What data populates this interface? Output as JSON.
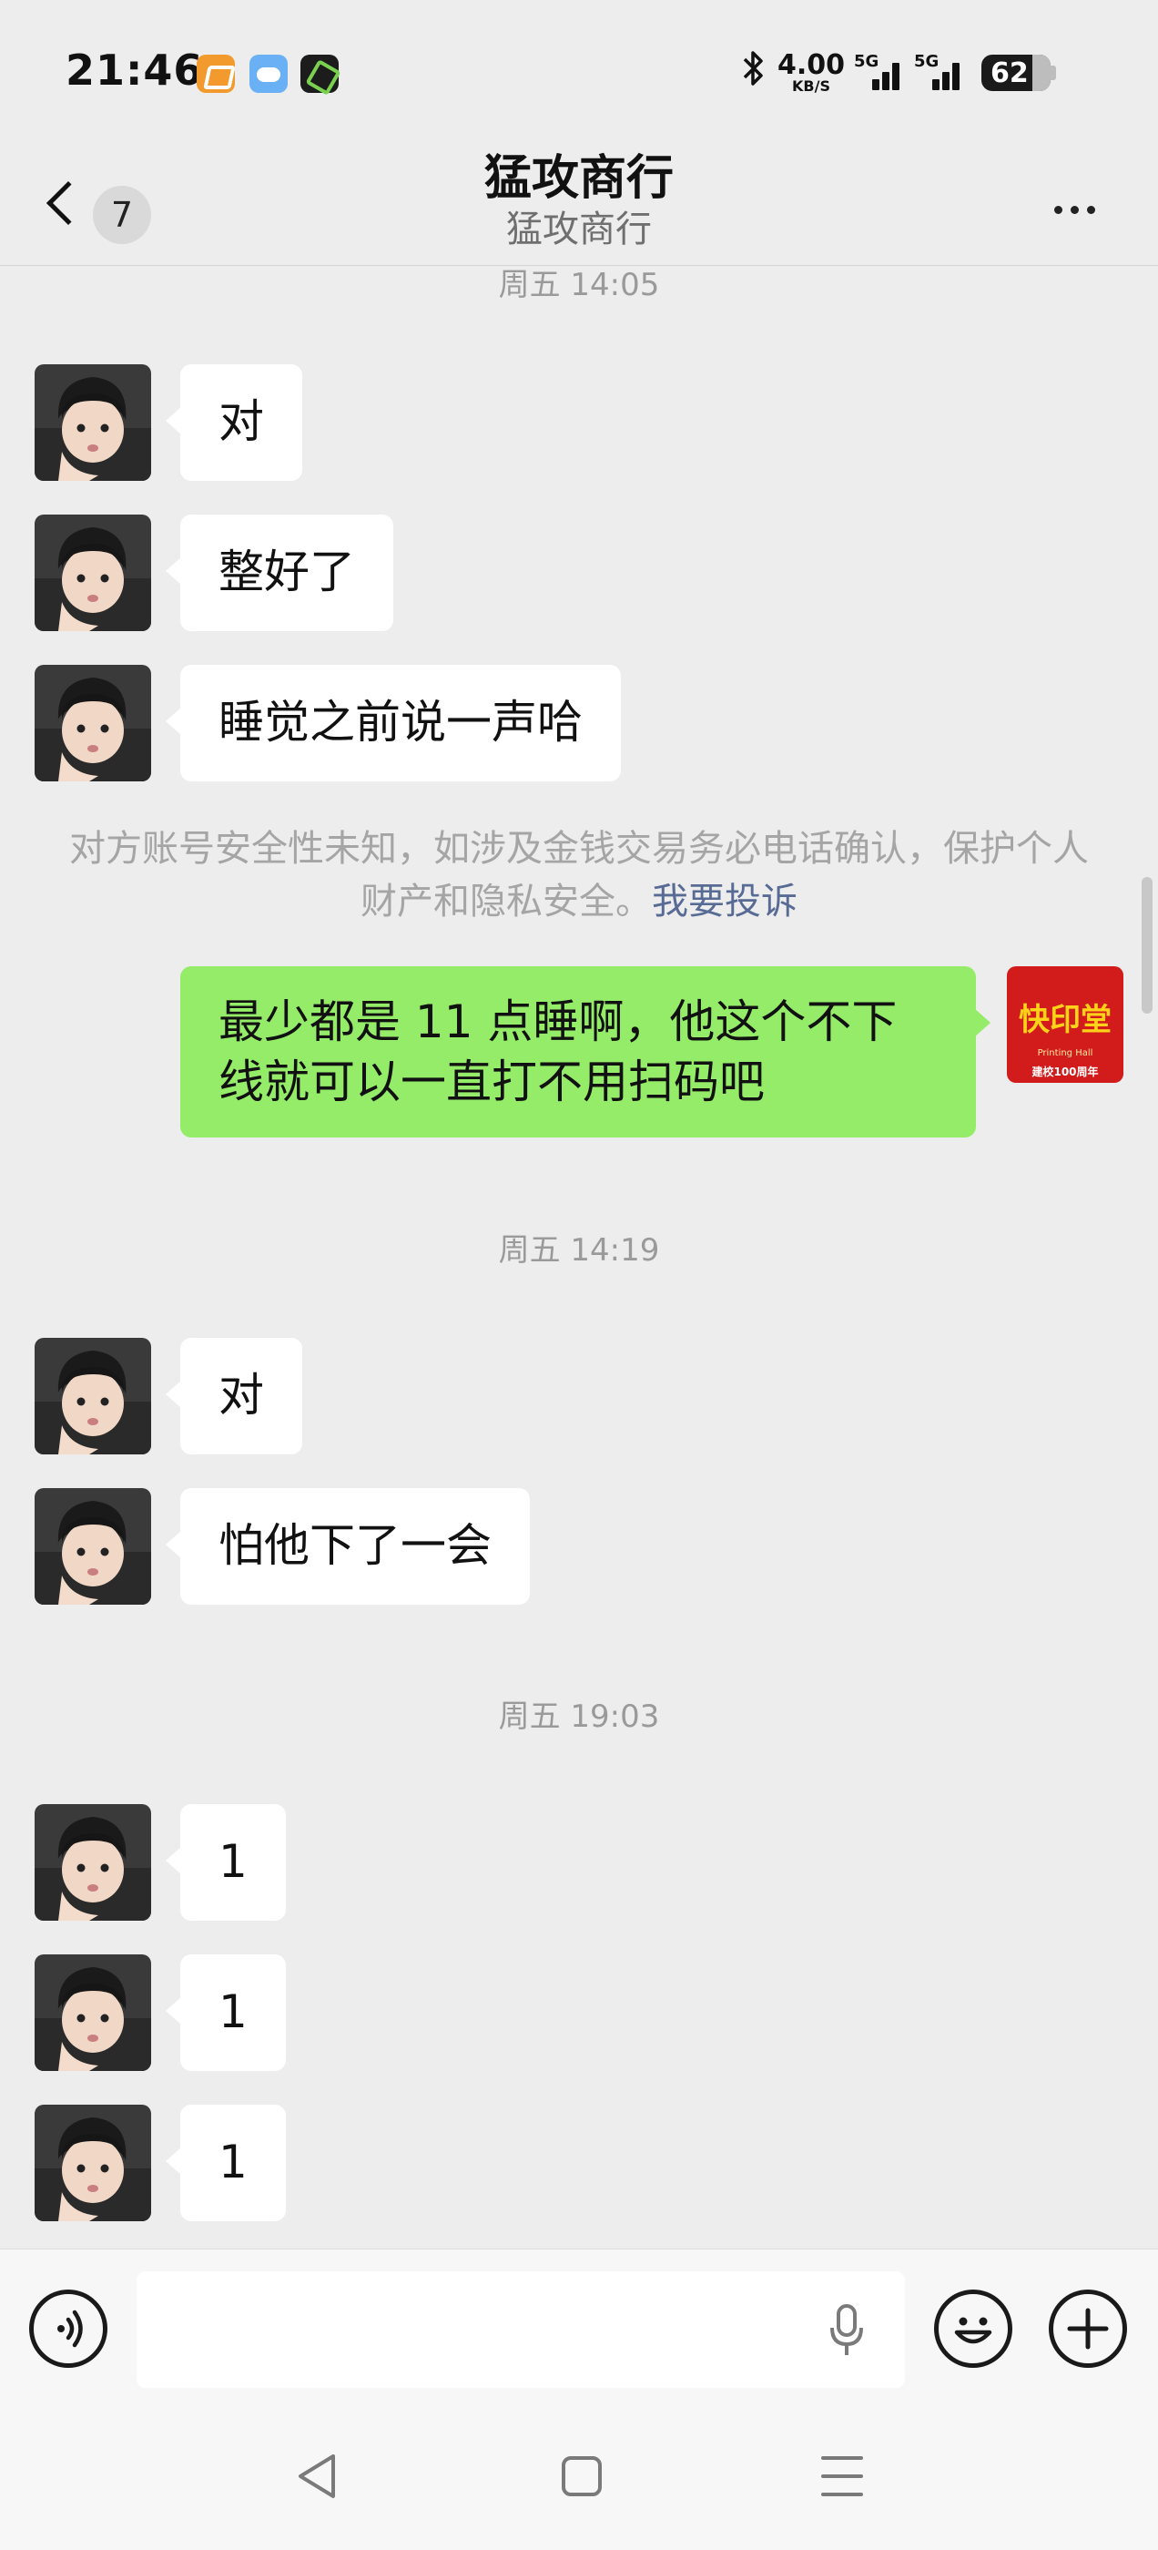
{
  "status_bar": {
    "time": "21:46",
    "net_speed_value": "4.00",
    "net_speed_unit": "KB/S",
    "signal1_label": "5G",
    "signal2_label": "5G",
    "battery": "62"
  },
  "header": {
    "unread_count": "7",
    "title": "猛攻商行",
    "subtitle": "猛攻商行"
  },
  "chat": {
    "timestamps": [
      "周五 14:05",
      "周五 14:19",
      "周五 19:03"
    ],
    "messages_group1": [
      "对",
      "整好了",
      "睡觉之前说一声哈"
    ],
    "notice_text": "对方账号安全性未知，如涉及金钱交易务必电话确认，保护个人财产和隐私安全。",
    "notice_link": "我要投诉",
    "outgoing_message": "最少都是 11 点睡啊，他这个不下线就可以一直打不用扫码吧",
    "my_avatar_text": "快印堂",
    "my_avatar_small1": "Printing Hall",
    "my_avatar_small2": "建校100周年",
    "messages_group2": [
      "对",
      "怕他下了一会"
    ],
    "messages_group3": [
      "1",
      "1",
      "1"
    ]
  },
  "input": {
    "placeholder": "",
    "value": ""
  },
  "colors": {
    "background": "#ededed",
    "incoming_bubble": "#ffffff",
    "outgoing_bubble": "#95ec69",
    "link": "#576b95"
  }
}
